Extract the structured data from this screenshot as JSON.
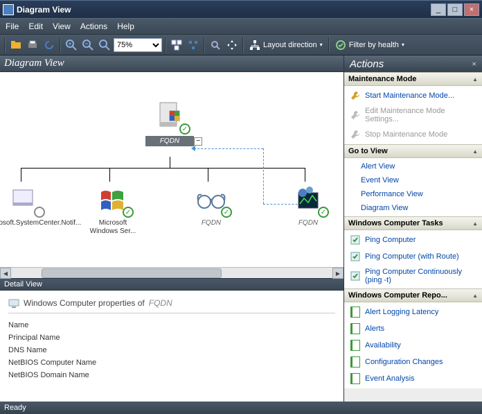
{
  "window": {
    "title": "Diagram View"
  },
  "menu": {
    "items": [
      "File",
      "Edit",
      "View",
      "Actions",
      "Help"
    ]
  },
  "toolbar": {
    "zoom_value": "75%",
    "layout_direction_label": "Layout direction",
    "filter_label": "Filter by health"
  },
  "view": {
    "header": "Diagram View"
  },
  "diagram": {
    "root": {
      "label": "FQDN",
      "expanded": true
    },
    "children": [
      {
        "caption": "rosoft.SystemCenter.Notif..."
      },
      {
        "caption": "Microsoft Windows Ser..."
      },
      {
        "caption": "FQDN"
      },
      {
        "caption": "FQDN"
      }
    ]
  },
  "detail": {
    "header": "Detail View",
    "title_prefix": "Windows Computer properties of",
    "title_subject": "FQDN",
    "rows": [
      "Name",
      "Principal Name",
      "DNS Name",
      "NetBIOS Computer Name",
      "NetBIOS Domain Name"
    ]
  },
  "actions": {
    "header": "Actions",
    "sections": [
      {
        "title": "Maintenance Mode",
        "items": [
          {
            "label": "Start Maintenance Mode...",
            "icon": "start-maint",
            "enabled": true
          },
          {
            "label": "Edit Maintenance Mode Settings...",
            "icon": "edit-maint",
            "enabled": false
          },
          {
            "label": "Stop Maintenance Mode",
            "icon": "stop-maint",
            "enabled": false
          }
        ]
      },
      {
        "title": "Go to View",
        "items": [
          {
            "label": "Alert View",
            "link": true
          },
          {
            "label": "Event View",
            "link": true
          },
          {
            "label": "Performance View",
            "link": true
          },
          {
            "label": "Diagram View",
            "link": true
          }
        ]
      },
      {
        "title": "Windows Computer Tasks",
        "items": [
          {
            "label": "Ping Computer",
            "icon": "task",
            "enabled": true
          },
          {
            "label": "Ping Computer (with Route)",
            "icon": "task",
            "enabled": true
          },
          {
            "label": "Ping Computer Continuously (ping -t)",
            "icon": "task",
            "enabled": true
          }
        ]
      },
      {
        "title": "Windows Computer Repo...",
        "items": [
          {
            "label": "Alert Logging Latency",
            "icon": "report",
            "enabled": true
          },
          {
            "label": "Alerts",
            "icon": "report",
            "enabled": true
          },
          {
            "label": "Availability",
            "icon": "report",
            "enabled": true
          },
          {
            "label": "Configuration Changes",
            "icon": "report",
            "enabled": true
          },
          {
            "label": "Event Analysis",
            "icon": "report",
            "enabled": true
          }
        ]
      }
    ]
  },
  "statusbar": {
    "text": "Ready"
  }
}
